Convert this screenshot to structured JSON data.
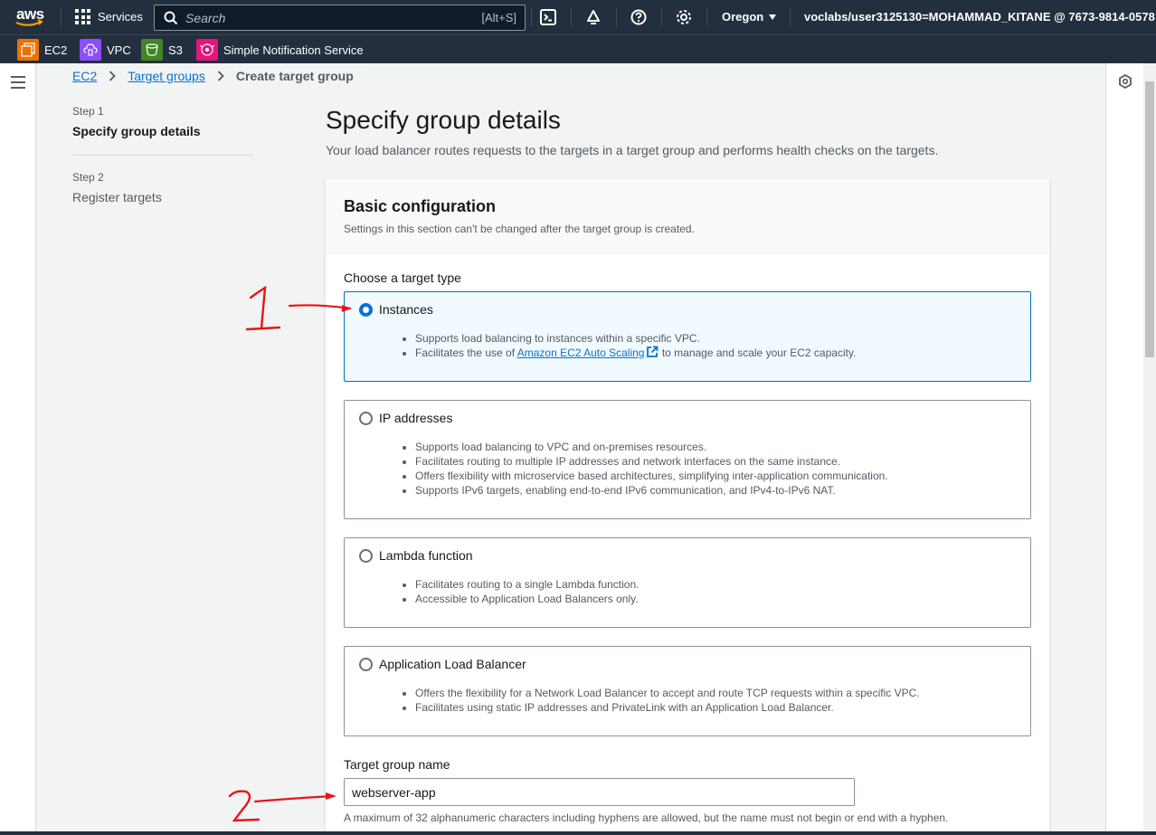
{
  "topnav": {
    "logo_text": "aws",
    "services_label": "Services",
    "search_placeholder": "Search",
    "search_shortcut": "[Alt+S]",
    "region": "Oregon",
    "account": "voclabs/user3125130=MOHAMMAD_KITANE @ 7673-9814-0578"
  },
  "favorites": [
    {
      "label": "EC2",
      "icon": "ec2-icon",
      "color": "#ed7100"
    },
    {
      "label": "VPC",
      "icon": "vpc-icon",
      "color": "#8c4fff"
    },
    {
      "label": "S3",
      "icon": "s3-icon",
      "color": "#3f8624"
    },
    {
      "label": "Simple Notification Service",
      "icon": "sns-icon",
      "color": "#e7157b"
    }
  ],
  "breadcrumb": {
    "items": [
      "EC2",
      "Target groups"
    ],
    "current": "Create target group"
  },
  "steps": [
    {
      "label": "Step 1",
      "title": "Specify group details"
    },
    {
      "label": "Step 2",
      "title": "Register targets"
    }
  ],
  "page": {
    "title": "Specify group details",
    "description": "Your load balancer routes requests to the targets in a target group and performs health checks on the targets."
  },
  "basic_config": {
    "title": "Basic configuration",
    "description": "Settings in this section can't be changed after the target group is created.",
    "target_type_label": "Choose a target type",
    "options": [
      {
        "title": "Instances",
        "selected": true,
        "bullets": [
          "Supports load balancing to instances within a specific VPC."
        ],
        "bullet2_prefix": "Facilitates the use of ",
        "bullet2_link": "Amazon EC2 Auto Scaling",
        "bullet2_suffix": " to manage and scale your EC2 capacity."
      },
      {
        "title": "IP addresses",
        "selected": false,
        "bullets": [
          "Supports load balancing to VPC and on-premises resources.",
          "Facilitates routing to multiple IP addresses and network interfaces on the same instance.",
          "Offers flexibility with microservice based architectures, simplifying inter-application communication.",
          "Supports IPv6 targets, enabling end-to-end IPv6 communication, and IPv4-to-IPv6 NAT."
        ]
      },
      {
        "title": "Lambda function",
        "selected": false,
        "bullets": [
          "Facilitates routing to a single Lambda function.",
          "Accessible to Application Load Balancers only."
        ]
      },
      {
        "title": "Application Load Balancer",
        "selected": false,
        "bullets": [
          "Offers the flexibility for a Network Load Balancer to accept and route TCP requests within a specific VPC.",
          "Facilitates using static IP addresses and PrivateLink with an Application Load Balancer."
        ]
      }
    ],
    "name_label": "Target group name",
    "name_value": "webserver-app",
    "name_hint": "A maximum of 32 alphanumeric characters including hyphens are allowed, but the name must not begin or end with a hyphen."
  },
  "annotations": {
    "marker1": "1",
    "marker2": "2",
    "color": "#e8141a"
  }
}
